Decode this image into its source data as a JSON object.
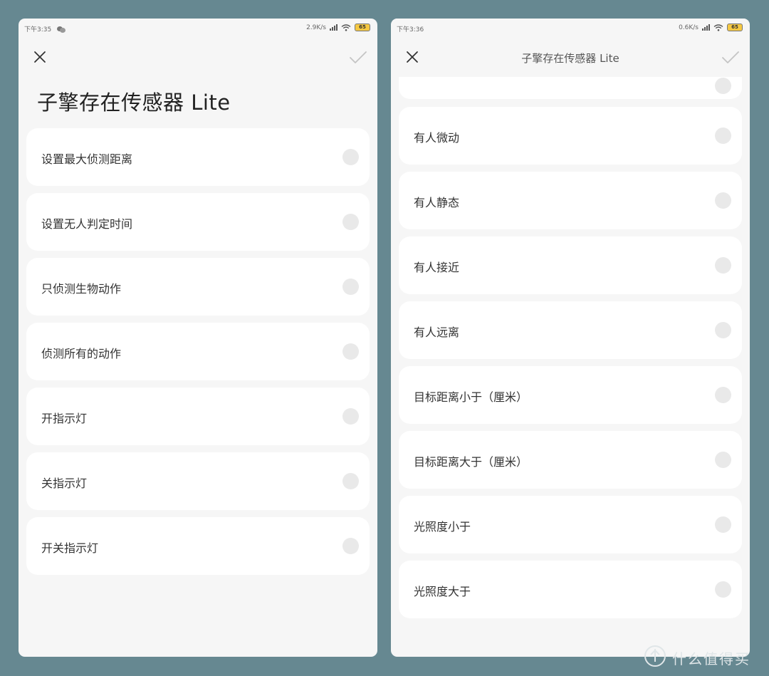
{
  "left": {
    "status": {
      "time": "下午3:35",
      "speed": "2.9K/s",
      "battery": "65"
    },
    "title": "子擎存在传感器 Lite",
    "items": [
      {
        "label": "设置最大侦测距离"
      },
      {
        "label": "设置无人判定时间"
      },
      {
        "label": "只侦测生物动作"
      },
      {
        "label": "侦测所有的动作"
      },
      {
        "label": "开指示灯"
      },
      {
        "label": "关指示灯"
      },
      {
        "label": "开关指示灯"
      }
    ]
  },
  "right": {
    "status": {
      "time": "下午3:36",
      "speed": "0.6K/s",
      "battery": "65"
    },
    "title": "子擎存在传感器 Lite",
    "items": [
      {
        "label": "有人微动"
      },
      {
        "label": "有人静态"
      },
      {
        "label": "有人接近"
      },
      {
        "label": "有人远离"
      },
      {
        "label": "目标距离小于（厘米）"
      },
      {
        "label": "目标距离大于（厘米）"
      },
      {
        "label": "光照度小于"
      },
      {
        "label": "光照度大于"
      }
    ]
  },
  "watermark": {
    "text": "什么值得买"
  },
  "icons": {
    "close": "close-icon",
    "confirm": "check-icon",
    "radio": "radio-icon",
    "wifi": "wifi-icon",
    "signal": "signal-icon",
    "battery": "battery-icon"
  },
  "colors": {
    "background": "#668891",
    "screen": "#f6f6f6",
    "card": "#ffffff",
    "radio": "#e9e9e9",
    "battery": "#f5c842"
  }
}
